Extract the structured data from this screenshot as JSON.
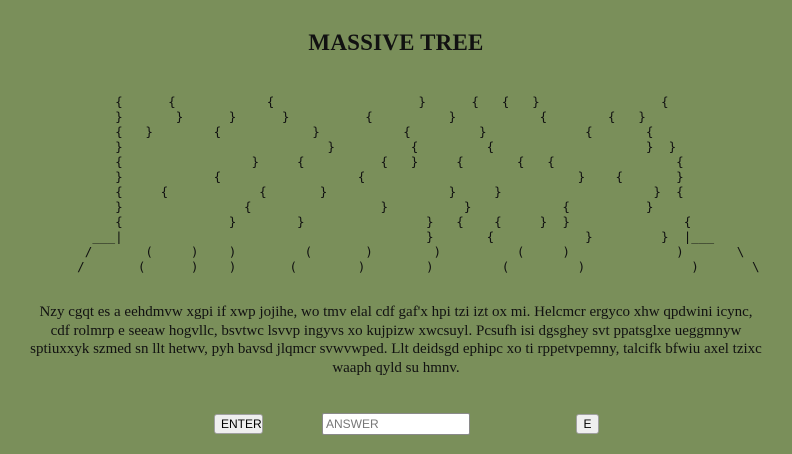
{
  "title": "MASSIVE TREE",
  "ascii_art": [
    "       {      {            {                   }      {   {   }                {",
    "       }       }      }      }          {          }           {        {   }",
    "       {   }        {            }           {         }             {       {",
    "       }                           }          {         {                    }  }",
    "       {                 }     {          {   }     {       {   {                {",
    "       }            {                  {                            }    {       }",
    "       {     {            {       }                }     }                    }  {",
    "       }                {                 }          }            {          }",
    "       {              }        }                }   {    {     }  }               {",
    "    ___|                                        }       {            }         }  |___",
    "   /       (     )    )         (       )        )          (     )              )       \\",
    "  /       (      )    )       (        )        )         (         )              )       \\"
  ],
  "paragraph": "Nzy cgqt es a eehdmvw xgpi if xwp jojihe, wo tmv elal cdf gaf'x hpi tzi izt ox mi.  Helcmcr ergyco xhw qpdwini icync, cdf rolmrp e seeaw hogvllc, bsvtwc lsvvp ingyvs xo kujpizw xwcsuyl.  Pcsufh isi dgsghey svt ppatsglxe ueggmnyw sptiuxxyk szmed sn llt hetwv, pyh bavsd jlqmcr svwvwped.  Llt deidsgd ephipc xo ti rppetvpemny, talcifk bfwiu axel tzixc waaph qyld su hmnv.",
  "controls": {
    "enter_label": "ENTER",
    "answer_placeholder": "ANSWER",
    "answer_value": "",
    "e_label": "E"
  }
}
